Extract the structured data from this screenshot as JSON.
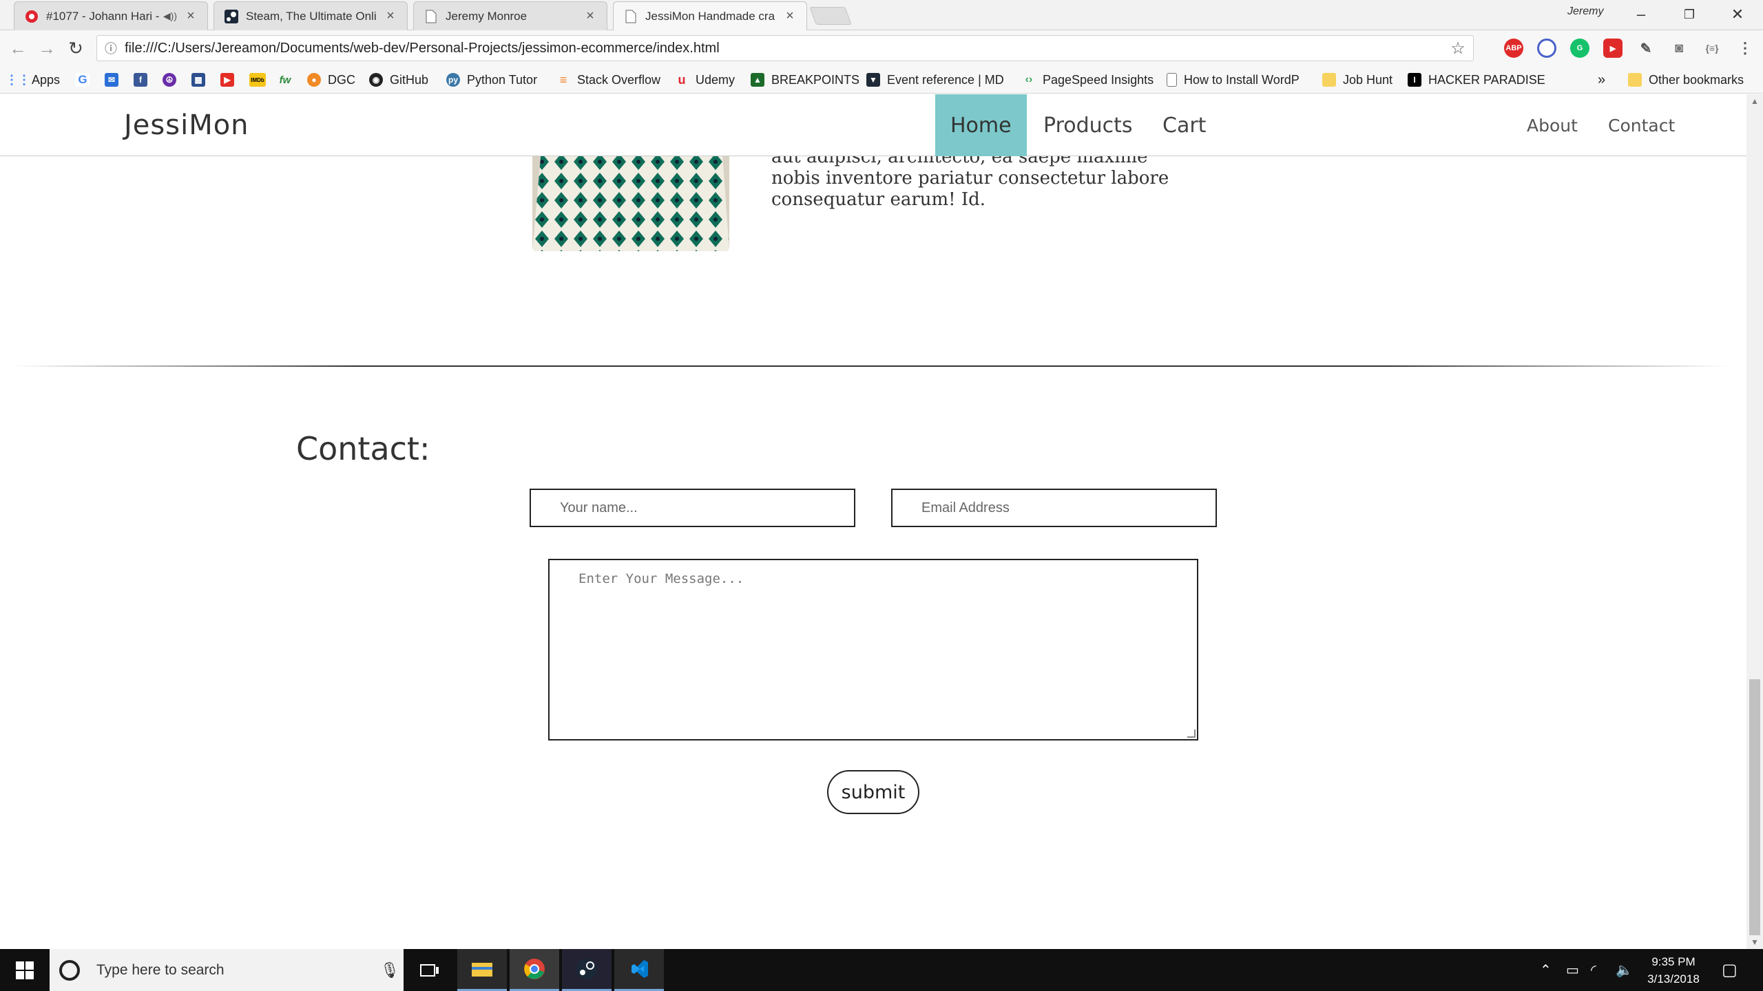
{
  "browser": {
    "tabs": [
      {
        "title": "#1077 - Johann Hari -",
        "icon": "podcast-icon",
        "audio": true,
        "active": false
      },
      {
        "title": "Steam, The Ultimate Onli",
        "icon": "steam-icon",
        "audio": false,
        "active": false
      },
      {
        "title": "Jeremy Monroe",
        "icon": "page-icon",
        "audio": false,
        "active": false
      },
      {
        "title": "JessiMon Handmade cra",
        "icon": "page-icon",
        "audio": false,
        "active": true
      }
    ],
    "profile_name": "Jeremy",
    "url": "file:///C:/Users/Jereamon/Documents/web-dev/Personal-Projects/jessimon-ecommerce/index.html",
    "bookmarks": [
      {
        "label": "Apps",
        "icon": "apps-grid-icon"
      },
      {
        "label": "",
        "icon": "google-icon"
      },
      {
        "label": "",
        "icon": "mail-icon"
      },
      {
        "label": "",
        "icon": "facebook-icon"
      },
      {
        "label": "",
        "icon": "peace-icon"
      },
      {
        "label": "",
        "icon": "calendar-icon"
      },
      {
        "label": "",
        "icon": "youtube-icon"
      },
      {
        "label": "",
        "icon": "imdb-icon"
      },
      {
        "label": "",
        "icon": "fw-icon"
      },
      {
        "label": "DGC",
        "icon": "dgc-icon"
      },
      {
        "label": "GitHub",
        "icon": "github-icon"
      },
      {
        "label": "Python Tutor",
        "icon": "python-icon"
      },
      {
        "label": "Stack Overflow",
        "icon": "stackoverflow-icon"
      },
      {
        "label": "Udemy",
        "icon": "udemy-icon"
      },
      {
        "label": "BREAKPOINTS",
        "icon": "breakpoints-icon"
      },
      {
        "label": "Event reference | MD",
        "icon": "mdn-icon"
      },
      {
        "label": "PageSpeed Insights",
        "icon": "pagespeed-icon"
      },
      {
        "label": "How to Install WordP",
        "icon": "page-icon"
      },
      {
        "label": "Job Hunt",
        "icon": "folder-icon"
      },
      {
        "label": "HACKER PARADISE",
        "icon": "hacker-icon"
      }
    ],
    "overflow_label": "»",
    "other_bookmarks": "Other bookmarks"
  },
  "site": {
    "brand": "JessiMon",
    "nav": {
      "home": "Home",
      "products": "Products",
      "cart": "Cart",
      "about": "About",
      "contact": "Contact"
    },
    "about_text": "aut adipisci, architecto, ea saepe maxime nobis inventore pariatur consectetur labore consequatur earum! Id.",
    "contact": {
      "title": "Contact:",
      "name_placeholder": "Your name...",
      "email_placeholder": "Email Address",
      "message_placeholder": "Enter Your Message...",
      "submit_label": "submit"
    },
    "accent_color": "#7cc8cb"
  },
  "taskbar": {
    "search_placeholder": "Type here to search",
    "time": "9:35 PM",
    "date": "3/13/2018"
  }
}
